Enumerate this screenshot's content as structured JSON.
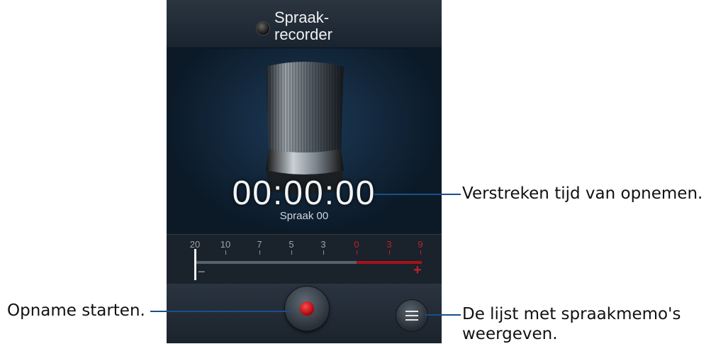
{
  "app": {
    "title_line1": "Spraak-",
    "title_line2": "recorder"
  },
  "recorder": {
    "elapsed_time": "00:00:00",
    "file_name": "Spraak 00"
  },
  "level_meter": {
    "ticks": [
      {
        "label": "20",
        "red": false
      },
      {
        "label": "10",
        "red": false
      },
      {
        "label": "7",
        "red": false
      },
      {
        "label": "5",
        "red": false
      },
      {
        "label": "3",
        "red": false
      },
      {
        "label": "0",
        "red": true
      },
      {
        "label": "3",
        "red": true
      },
      {
        "label": "9",
        "red": true
      }
    ],
    "minus": "−",
    "plus": "+"
  },
  "annotations": {
    "elapsed": "Verstreken tijd van opnemen.",
    "start": "Opname starten.",
    "list_line1": "De lijst met spraakmemo's",
    "list_line2": "weergeven."
  },
  "icons": {
    "record": "record-icon",
    "list": "list-icon",
    "microphone": "microphone-icon",
    "app": "app-icon"
  },
  "colors": {
    "accent_red": "#c0202a",
    "callout_line": "#1a4f8a"
  }
}
